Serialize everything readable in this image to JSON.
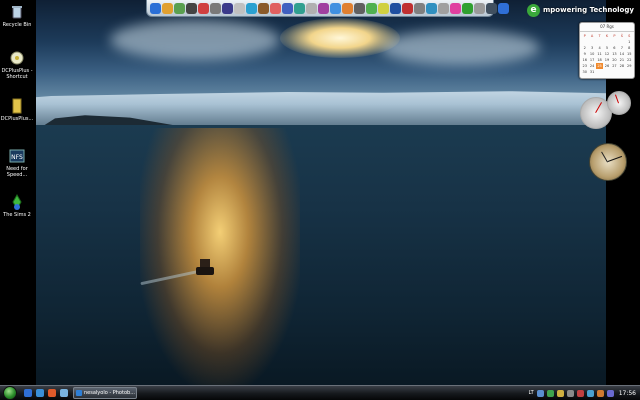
{
  "desktop": {
    "icons": [
      {
        "label": "Recycle Bin",
        "icon": "recycle-bin-icon"
      },
      {
        "label": "DCPlusPlus - Shortcut",
        "icon": "dcplusplus-shortcut-icon"
      },
      {
        "label": "DCPlusPlus...",
        "icon": "folder-icon"
      },
      {
        "label": "Need for Speed...",
        "icon": "nfs-game-icon"
      },
      {
        "label": "The Sims 2",
        "icon": "sims2-icon"
      }
    ]
  },
  "branding": {
    "text": "mpowering Technology",
    "logo_letter": "e"
  },
  "calendar": {
    "header": "07 Rgs",
    "weekday_labels": [
      "P",
      "A",
      "T",
      "K",
      "P",
      "Š",
      "S"
    ],
    "days": [
      "",
      "",
      "",
      "",
      "",
      "",
      "1",
      "2",
      "3",
      "4",
      "5",
      "6",
      "7",
      "8",
      "9",
      "10",
      "11",
      "12",
      "13",
      "14",
      "15",
      "16",
      "17",
      "18",
      "19",
      "20",
      "21",
      "22",
      "23",
      "24",
      "25",
      "26",
      "27",
      "28",
      "29",
      "30",
      "31",
      "",
      "",
      "",
      ""
    ],
    "today": "25"
  },
  "taskbar": {
    "task_label": "nesalyolo - Photob...",
    "language": "LT",
    "time": "17:56"
  },
  "colors": {
    "taskbar_bg": "#15181c",
    "start_orb": "#2a8d2a",
    "calendar_today": "#f08a2e"
  }
}
